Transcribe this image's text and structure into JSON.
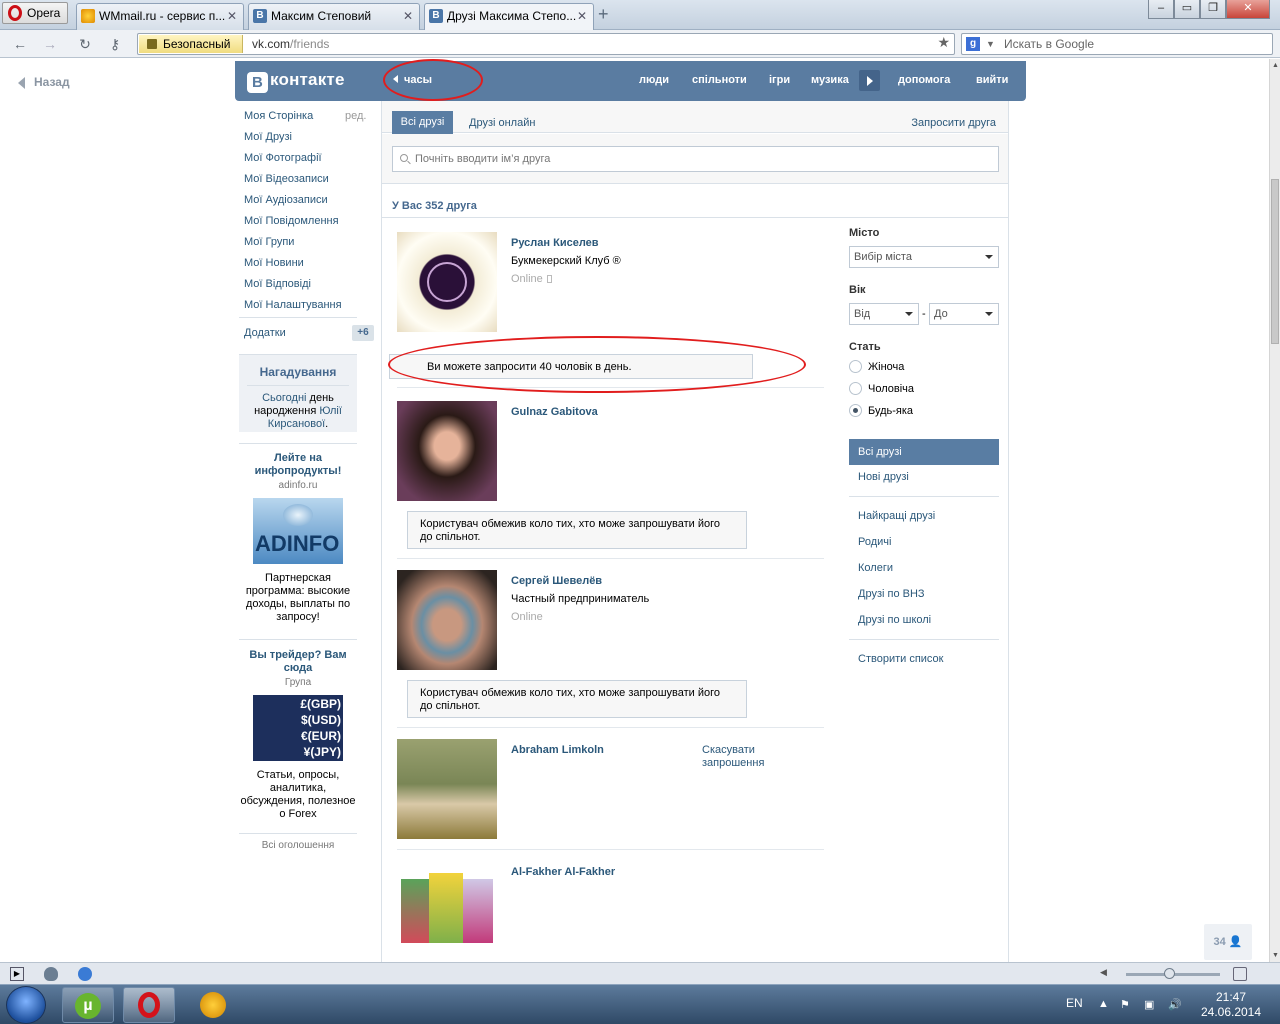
{
  "browser": {
    "menu_label": "Opera",
    "tabs": [
      {
        "label": "WMmail.ru - сервис п...",
        "icon": "wmmail-favicon"
      },
      {
        "label": "Максим Степовий",
        "icon": "vk-favicon"
      },
      {
        "label": "Друзі Максима Степо...",
        "icon": "vk-favicon"
      }
    ],
    "new_tab_icon": "plus-icon",
    "window_buttons": [
      "minimize",
      "restore",
      "close"
    ],
    "security_label": "Безопасный",
    "url_host": "vk.com",
    "url_path": "/friends",
    "search_placeholder": "Искать в Google"
  },
  "page": {
    "back_label": "Назад",
    "header": {
      "logo": "контакте",
      "logo_letter": "В",
      "player_label": "часы",
      "nav": [
        "люди",
        "спільноти",
        "ігри",
        "музика",
        "допомога",
        "вийти"
      ]
    },
    "left_menu": {
      "items": [
        "Моя Сторінка",
        "Мої Друзі",
        "Мої Фотографії",
        "Мої Відеозаписи",
        "Мої Аудіозаписи",
        "Мої Повідомлення",
        "Мої Групи",
        "Мої Новини",
        "Мої Відповіді",
        "Мої Налаштування"
      ],
      "edit_label": "ред.",
      "apps_label": "Додатки",
      "apps_badge": "+6"
    },
    "reminder": {
      "title": "Нагадування",
      "text_link1": "Сьогодні",
      "text_mid": " день народження ",
      "text_link2": "Юлії Кирсанової",
      "text_end": "."
    },
    "ads": [
      {
        "title": "Лейте на инфопродукты!",
        "subtitle": "adinfo.ru",
        "image_text": "ADINFO",
        "text": "Партнерская программа: высокие доходы, выплаты по запросу!"
      },
      {
        "title": "Вы трейдер? Вам сюда",
        "subtitle": "Група",
        "image_lines": [
          "£(GBP)",
          "$(USD)",
          "€(EUR)",
          "¥(JPY)"
        ],
        "text": "Статьи, опросы, аналитика, обсуждения, полезное о Forex"
      }
    ],
    "all_ads_label": "Всі оголошення",
    "tabs": {
      "all": "Всі друзі",
      "online": "Друзі онлайн",
      "invite": "Запросити друга"
    },
    "search_placeholder": "Почніть вводити ім’я друга",
    "friends_count": "У Вас 352 друга",
    "friends": [
      {
        "name": "Руслан Киселев",
        "extra": "Букмекерский Клуб ®",
        "status": "Online",
        "photo": "bookmaker-club-logo"
      },
      {
        "name": "Gulnaz Gabitova",
        "photo": "woman-portrait"
      },
      {
        "name": "Сергей Шевелёв",
        "extra": "Частный предприниматель",
        "status": "Online",
        "photo": "bodybuilder-photo"
      },
      {
        "name": "Abraham Limkoln",
        "action": "Скасувати запрошення",
        "photo": "woman-jump-rope"
      },
      {
        "name": "Al-Fakher Al-Fakher",
        "photo": "tobacco-packs"
      }
    ],
    "notices": {
      "invite_limit": "Ви можете запросити 40 чоловік в день.",
      "restricted": "Користувач обмежив коло тих, хто може запрошувати його до спільнот."
    },
    "filter": {
      "city_label": "Місто",
      "city_placeholder": "Вибір міста",
      "age_label": "Вік",
      "age_from": "Від",
      "age_dash": "-",
      "age_to": "До",
      "gender_label": "Стать",
      "genders": [
        "Жіноча",
        "Чоловіча",
        "Будь-яка"
      ],
      "selected_gender": "Будь-яка",
      "lists": [
        "Всі друзі",
        "Нові друзі",
        "Найкращі друзі",
        "Родичі",
        "Колеги",
        "Друзі по ВНЗ",
        "Друзі по школі",
        "Створити список"
      ],
      "selected_list": "Всі друзі"
    },
    "online_counter": "34"
  },
  "taskbar": {
    "language": "EN",
    "time": "21:47",
    "date": "24.06.2014",
    "apps": [
      "utorrent-icon",
      "opera-icon",
      "aimp-icon"
    ]
  }
}
